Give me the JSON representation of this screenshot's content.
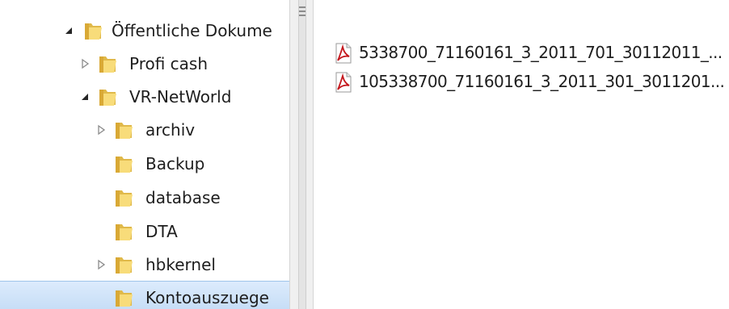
{
  "tree": {
    "items": [
      {
        "label": "Öffentliche Dokume",
        "expanded": true,
        "has_children": true
      },
      {
        "label": "Profi cash",
        "expanded": false,
        "has_children": true
      },
      {
        "label": "VR-NetWorld",
        "expanded": true,
        "has_children": true
      },
      {
        "label": "archiv",
        "expanded": false,
        "has_children": true
      },
      {
        "label": "Backup",
        "expanded": false,
        "has_children": false
      },
      {
        "label": "database",
        "expanded": false,
        "has_children": false
      },
      {
        "label": "DTA",
        "expanded": false,
        "has_children": false
      },
      {
        "label": "hbkernel",
        "expanded": false,
        "has_children": true
      },
      {
        "label": "Kontoauszuege",
        "expanded": false,
        "has_children": false,
        "selected": true
      }
    ]
  },
  "files": {
    "items": [
      {
        "name": "5338700_71160161_3_2011_701_30112011_...",
        "icon": "pdf-icon"
      },
      {
        "name": "105338700_71160161_3_2011_301_3011201...",
        "icon": "pdf-icon"
      }
    ]
  },
  "colors": {
    "folder_back": "#e0b94a",
    "folder_front": "#f8dc7a",
    "pdf_red": "#c4161c",
    "selection": "#cce8ff",
    "splitter": "#f0f0f0"
  }
}
